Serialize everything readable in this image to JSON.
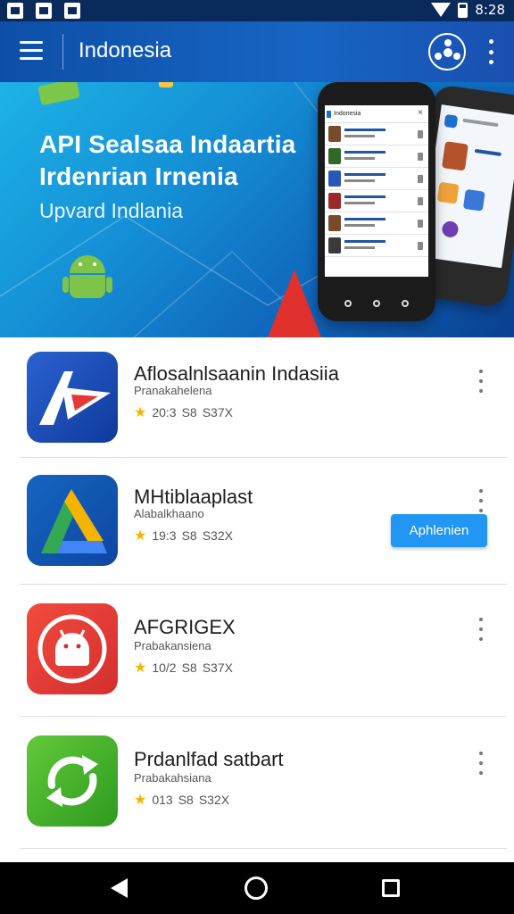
{
  "status_bar": {
    "time": "8:28",
    "icons": [
      "gallery-icon",
      "photo-icon",
      "image-icon",
      "wifi-icon",
      "battery-icon"
    ]
  },
  "app_bar": {
    "title": "Indonesia",
    "icons": [
      "menu-icon",
      "share-icon",
      "more-vert-icon"
    ]
  },
  "banner": {
    "line1": "API Sealsaa Indaartia",
    "line2": "Irdenrian Irnenia",
    "subtitle": "Upvard Indlania",
    "phone_header": "Indonesia",
    "colors": {
      "gradient_start": "#1db3e6",
      "gradient_end": "#0a3f8e",
      "accent": "#e0312f"
    }
  },
  "apps": [
    {
      "name": "Aflosalnlsaanin Indasiia",
      "developer": "Pranakahelena",
      "rating": "20:3",
      "size_a": "S8",
      "size_b": "S37X",
      "icon": "app-logo-red-a-icon",
      "icon_colors": [
        "#2b5fc9",
        "#0f3a9c"
      ]
    },
    {
      "name": "MHtiblaaplast",
      "developer": "Alabalkhaano",
      "rating": "19:3",
      "size_a": "S8",
      "size_b": "S32X",
      "icon": "app-logo-triangle-icon",
      "install_label": "Aphlenien",
      "icon_colors": [
        "#1565c0",
        "#0d47a1"
      ]
    },
    {
      "name": "AFGRIGEX",
      "developer": "Prabakansiena",
      "rating": "10/2",
      "size_a": "S8",
      "size_b": "S37X",
      "icon": "app-logo-android-red-icon",
      "icon_colors": [
        "#f0473a",
        "#d32f2f"
      ]
    },
    {
      "name": "Prdanlfad satbart",
      "developer": "Prabakahsiana",
      "rating": "013",
      "size_a": "S8",
      "size_b": "S32X",
      "icon": "app-logo-sync-green-icon",
      "icon_colors": [
        "#5bc236",
        "#2e9a1f"
      ]
    }
  ],
  "nav_bar": {
    "icons": [
      "back-icon",
      "home-icon",
      "recents-icon"
    ]
  }
}
